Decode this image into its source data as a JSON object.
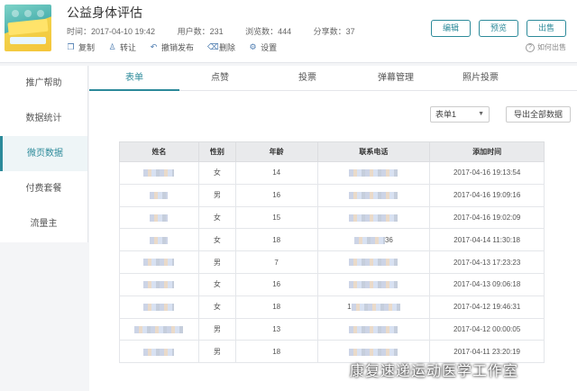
{
  "header": {
    "title": "公益身体评估",
    "meta": {
      "time": "时间：2017-04-10 19:42",
      "users": "用户数：231",
      "views": "浏览数：444",
      "shares": "分享数：37"
    },
    "actions": [
      "复制",
      "转让",
      "撤销发布",
      "删除",
      "设置"
    ],
    "buttons": {
      "edit": "编辑",
      "preview": "预览",
      "publish": "出售"
    },
    "help": "如何出售"
  },
  "sidebar": {
    "items": [
      "推广帮助",
      "数据统计",
      "微页数据",
      "付费套餐",
      "流量主"
    ],
    "active": "微页数据"
  },
  "tabs": [
    "表单",
    "点赞",
    "投票",
    "弹幕管理",
    "照片投票"
  ],
  "toolbar": {
    "select_value": "表单1",
    "export_label": "导出全部数据"
  },
  "table": {
    "headers": [
      "姓名",
      "性别",
      "年龄",
      "联系电话",
      "添加时间"
    ],
    "rows": [
      {
        "gender": "女",
        "age": "14",
        "time": "2017-04-16 19:13:54"
      },
      {
        "gender": "男",
        "age": "16",
        "time": "2017-04-16 19:09:16"
      },
      {
        "gender": "女",
        "age": "15",
        "time": "2017-04-16 19:02:09"
      },
      {
        "gender": "女",
        "age": "18",
        "phone_suffix": "36",
        "time": "2017-04-14 11:30:18"
      },
      {
        "gender": "男",
        "age": "7",
        "time": "2017-04-13 17:23:23"
      },
      {
        "gender": "女",
        "age": "16",
        "time": "2017-04-13 09:06:18"
      },
      {
        "gender": "女",
        "age": "18",
        "phone_prefix": "1",
        "time": "2017-04-12 19:46:31"
      },
      {
        "gender": "男",
        "age": "13",
        "time": "2017-04-12 00:00:05"
      },
      {
        "gender": "男",
        "age": "18",
        "time": "2017-04-11 23:20:19"
      }
    ]
  },
  "watermark": "康复速递运动医学工作室"
}
